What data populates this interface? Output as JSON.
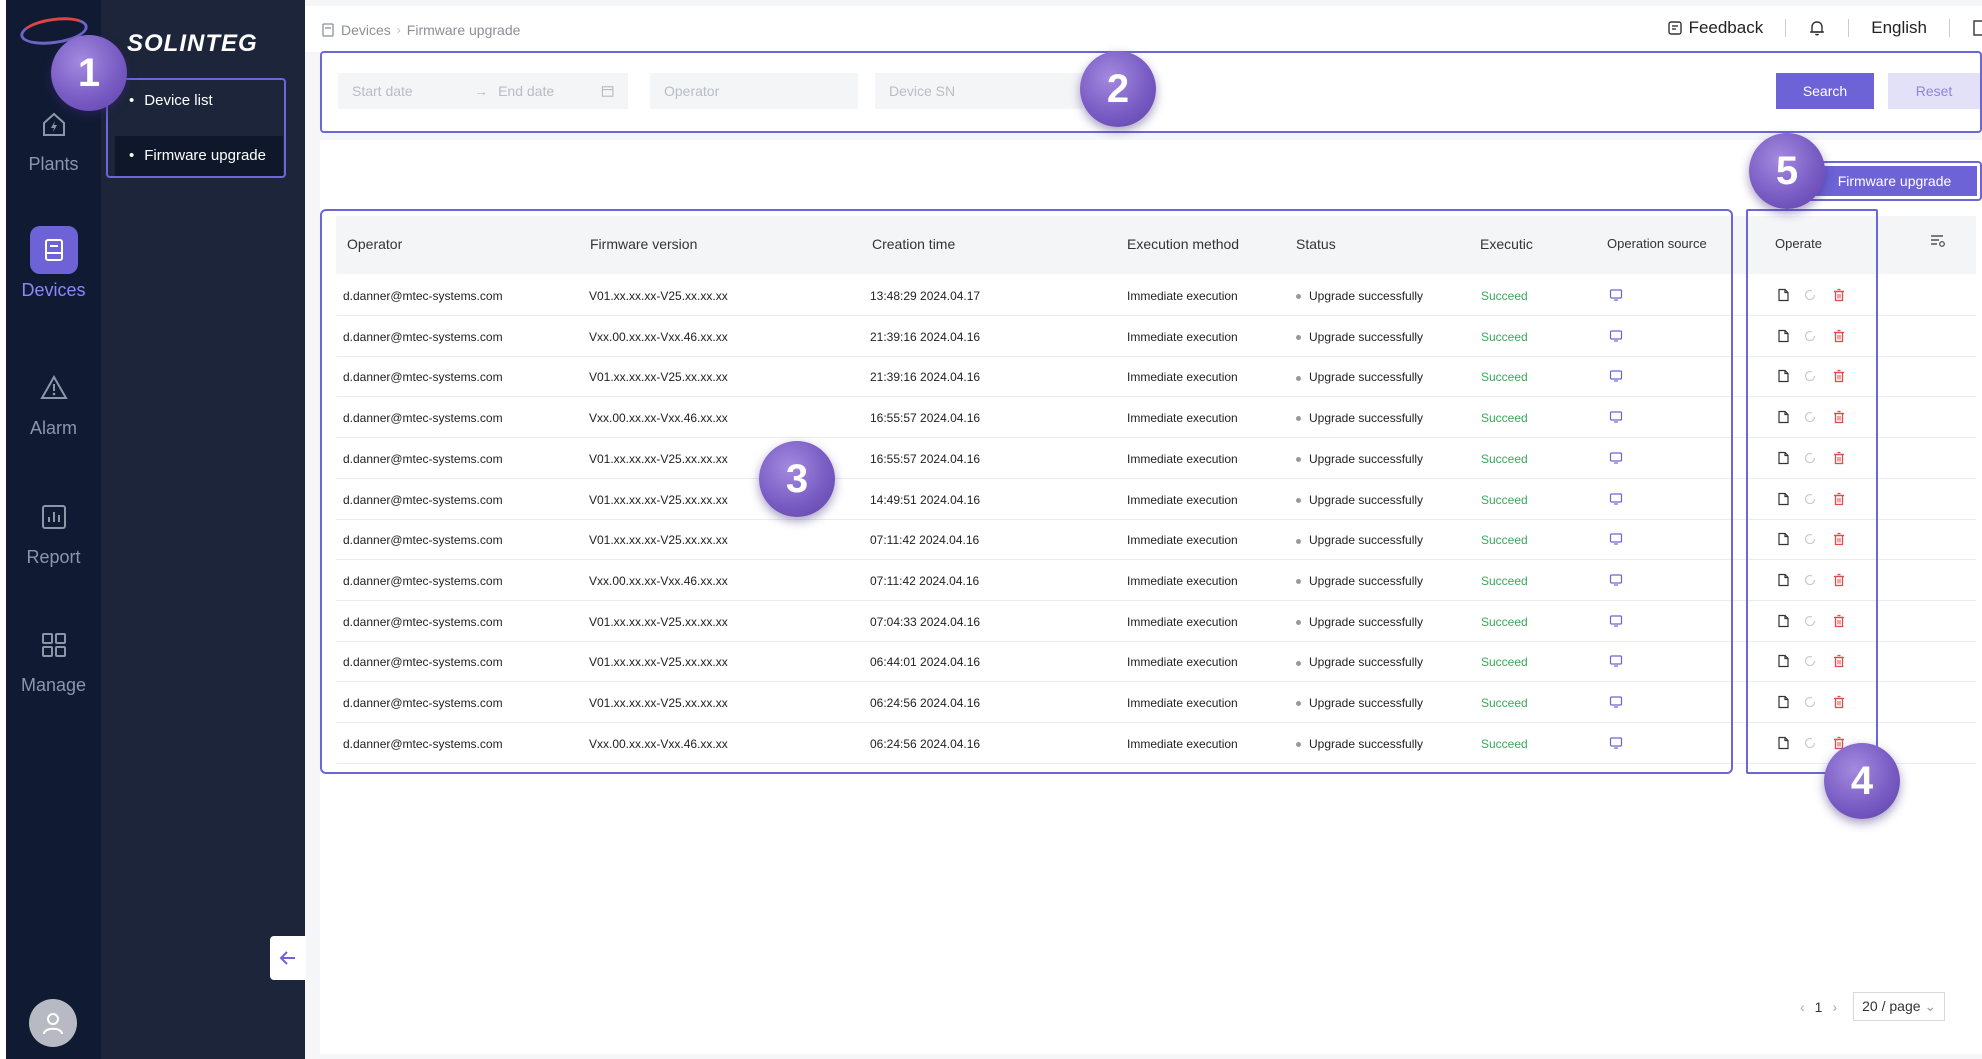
{
  "brand": {
    "name": "SOLINTEG"
  },
  "rail": {
    "items": [
      {
        "label": "Plants",
        "icon": "plant-icon"
      },
      {
        "label": "Devices",
        "icon": "device-icon"
      },
      {
        "label": "Alarm",
        "icon": "alarm-icon"
      },
      {
        "label": "Report",
        "icon": "report-icon"
      },
      {
        "label": "Manage",
        "icon": "manage-icon"
      }
    ],
    "active": "Devices"
  },
  "subnav": {
    "items": [
      {
        "label": "Device list"
      },
      {
        "label": "Firmware upgrade"
      }
    ],
    "active": "Firmware upgrade"
  },
  "breadcrumb": {
    "root": "Devices",
    "current": "Firmware upgrade"
  },
  "topbar": {
    "feedback": "Feedback",
    "language": "English"
  },
  "filters": {
    "start_date_placeholder": "Start date",
    "end_date_placeholder": "End date",
    "operator_placeholder": "Operator",
    "device_sn_placeholder": "Device SN",
    "search_label": "Search",
    "reset_label": "Reset"
  },
  "actions": {
    "firmware_upgrade_label": "Firmware upgrade"
  },
  "table": {
    "headers": {
      "operator": "Operator",
      "firmware_version": "Firmware version",
      "creation_time": "Creation time",
      "execution_method": "Execution method",
      "status": "Status",
      "execution": "Executic",
      "operation_source": "Operation source",
      "operate": "Operate"
    },
    "rows": [
      {
        "operator": "d.danner@mtec-systems.com",
        "firmware": "V01.xx.xx.xx-V25.xx.xx.xx",
        "time": "13:48:29 2024.04.17",
        "method": "Immediate execution",
        "status": "Upgrade successfully",
        "exec": "Succeed"
      },
      {
        "operator": "d.danner@mtec-systems.com",
        "firmware": "Vxx.00.xx.xx-Vxx.46.xx.xx",
        "time": "21:39:16 2024.04.16",
        "method": "Immediate execution",
        "status": "Upgrade successfully",
        "exec": "Succeed"
      },
      {
        "operator": "d.danner@mtec-systems.com",
        "firmware": "V01.xx.xx.xx-V25.xx.xx.xx",
        "time": "21:39:16 2024.04.16",
        "method": "Immediate execution",
        "status": "Upgrade successfully",
        "exec": "Succeed"
      },
      {
        "operator": "d.danner@mtec-systems.com",
        "firmware": "Vxx.00.xx.xx-Vxx.46.xx.xx",
        "time": "16:55:57 2024.04.16",
        "method": "Immediate execution",
        "status": "Upgrade successfully",
        "exec": "Succeed"
      },
      {
        "operator": "d.danner@mtec-systems.com",
        "firmware": "V01.xx.xx.xx-V25.xx.xx.xx",
        "time": "16:55:57 2024.04.16",
        "method": "Immediate execution",
        "status": "Upgrade successfully",
        "exec": "Succeed"
      },
      {
        "operator": "d.danner@mtec-systems.com",
        "firmware": "V01.xx.xx.xx-V25.xx.xx.xx",
        "time": "14:49:51 2024.04.16",
        "method": "Immediate execution",
        "status": "Upgrade successfully",
        "exec": "Succeed"
      },
      {
        "operator": "d.danner@mtec-systems.com",
        "firmware": "V01.xx.xx.xx-V25.xx.xx.xx",
        "time": "07:11:42 2024.04.16",
        "method": "Immediate execution",
        "status": "Upgrade successfully",
        "exec": "Succeed"
      },
      {
        "operator": "d.danner@mtec-systems.com",
        "firmware": "Vxx.00.xx.xx-Vxx.46.xx.xx",
        "time": "07:11:42 2024.04.16",
        "method": "Immediate execution",
        "status": "Upgrade successfully",
        "exec": "Succeed"
      },
      {
        "operator": "d.danner@mtec-systems.com",
        "firmware": "V01.xx.xx.xx-V25.xx.xx.xx",
        "time": "07:04:33 2024.04.16",
        "method": "Immediate execution",
        "status": "Upgrade successfully",
        "exec": "Succeed"
      },
      {
        "operator": "d.danner@mtec-systems.com",
        "firmware": "V01.xx.xx.xx-V25.xx.xx.xx",
        "time": "06:44:01 2024.04.16",
        "method": "Immediate execution",
        "status": "Upgrade successfully",
        "exec": "Succeed"
      },
      {
        "operator": "d.danner@mtec-systems.com",
        "firmware": "V01.xx.xx.xx-V25.xx.xx.xx",
        "time": "06:24:56 2024.04.16",
        "method": "Immediate execution",
        "status": "Upgrade successfully",
        "exec": "Succeed"
      },
      {
        "operator": "d.danner@mtec-systems.com",
        "firmware": "Vxx.00.xx.xx-Vxx.46.xx.xx",
        "time": "06:24:56 2024.04.16",
        "method": "Immediate execution",
        "status": "Upgrade successfully",
        "exec": "Succeed"
      }
    ]
  },
  "pagination": {
    "current": "1",
    "page_size": "20 / page"
  },
  "badges": [
    "1",
    "2",
    "3",
    "4",
    "5"
  ],
  "colors": {
    "accent": "#6d63d6",
    "highlight_border": "#6b67d8",
    "rail_bg": "#101b33",
    "subnav_bg": "#1c2539",
    "succeed": "#3aa85a",
    "delete": "#e04b4b"
  }
}
